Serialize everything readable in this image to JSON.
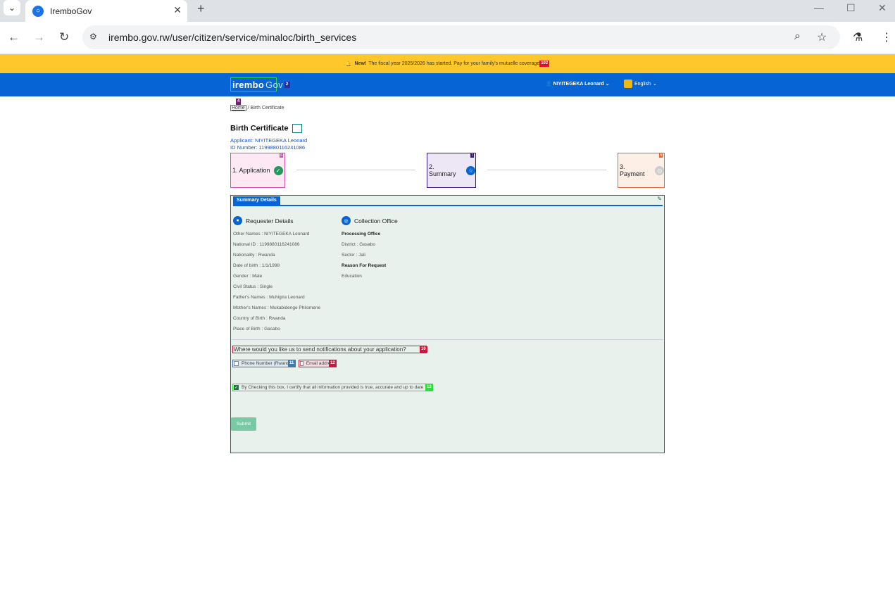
{
  "browser": {
    "tab_title": "IremboGov",
    "url": "irembo.gov.rw/user/citizen/service/minaloc/birth_services"
  },
  "banner": {
    "new_label": "New!",
    "text": "The fiscal year 2025/2026 has started. Pay for your family's mutuelle coverage",
    "tag": "102"
  },
  "header": {
    "logo_text": "irembo",
    "logo_suffix": "Gov",
    "logo_tag": "2",
    "user_name": "NIYITEGEKA Leonard",
    "language": "English"
  },
  "breadcrumb": {
    "home": "Home",
    "current": "/ Birth Certificate",
    "tag": "4"
  },
  "page": {
    "title": "Birth Certificate",
    "applicant": "Applicant: NIYITEGEKA Leonard",
    "id_number": "ID Number: 1199880116241086"
  },
  "steps": [
    {
      "label": "1. Application",
      "tag": "6"
    },
    {
      "label": "2. Summary",
      "tag": "7"
    },
    {
      "label": "3. Payment",
      "tag": "8"
    }
  ],
  "summary": {
    "tab_label": "Summary Details",
    "requester_heading": "Requester Details",
    "requester": [
      "Other Names : NIYITEGEKA Leonard",
      "National ID : 1199880116241086",
      "Nationality : Rwanda",
      "Date of birth : 1/1/1998",
      "Gender : Male",
      "Civil Status : Single",
      "Father's Names : Muhigira Leonard",
      "Mother's Names : Mukabidenge Philomene",
      "Country of Birth : Rwanda",
      "Place of Birth : Gasabo"
    ],
    "collection_heading": "Collection Office",
    "processing_office_label": "Processing Office",
    "district": "District : Gasabo",
    "sector": "Sector : Jali",
    "reason_label": "Reason For Request",
    "reason": "Education"
  },
  "notifications": {
    "question": "Where would you like us to send notifications about your application?",
    "question_tag": "10",
    "phone_label": "Phone Number (Rwanda)",
    "phone_tag": "11",
    "email_label": "Email address",
    "email_tag": "12"
  },
  "certify": {
    "text": "By Checking this box, I certify that all information provided is true, accurate and up to date",
    "tag": "13"
  },
  "submit_label": "Submit",
  "colors": {
    "header_blue": "#0764d4",
    "banner_yellow": "#fec82c",
    "card_bg": "#e8f1ec",
    "success_green": "#167a3c"
  }
}
